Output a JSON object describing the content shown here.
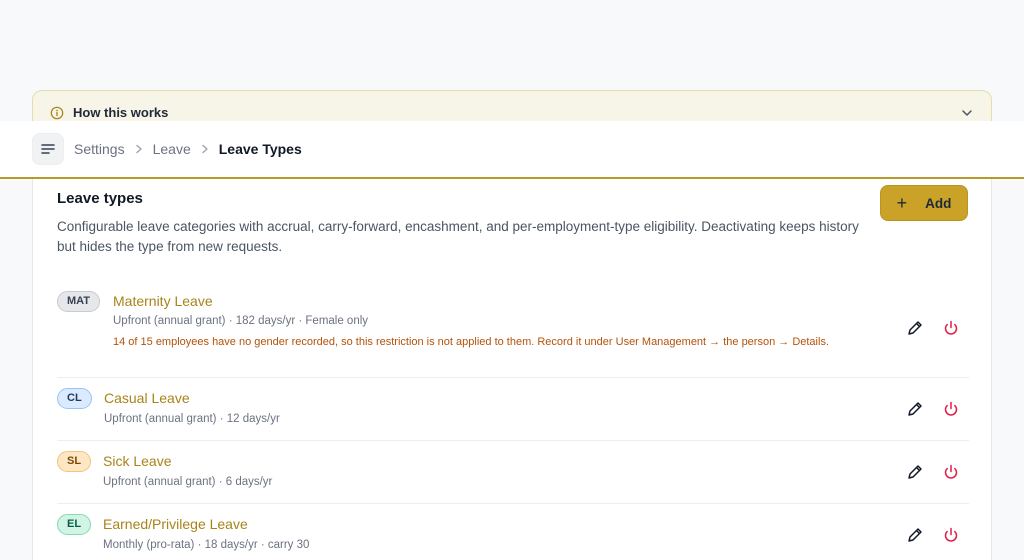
{
  "info_banner": {
    "title": "How this works",
    "icon": "info-icon"
  },
  "breadcrumb": {
    "items": [
      "Settings",
      "Leave"
    ],
    "current": "Leave Types"
  },
  "card": {
    "title": "Leave types",
    "description": "Configurable leave categories with accrual, carry-forward, encashment, and per-employment-type eligibility. Deactivating keeps history but hides the type from new requests.",
    "add_label": "Add"
  },
  "leave_types": [
    {
      "code": "MAT",
      "name": "Maternity Leave",
      "meta": "Upfront (annual grant) · 182 days/yr · Female only",
      "warning": "14 of 15 employees have no gender recorded, so this restriction is not applied to them. Record it under User Management → the person → Details."
    },
    {
      "code": "CL",
      "name": "Casual Leave",
      "meta": "Upfront (annual grant) · 12 days/yr"
    },
    {
      "code": "SL",
      "name": "Sick Leave",
      "meta": "Upfront (annual grant) · 6 days/yr"
    },
    {
      "code": "EL",
      "name": "Earned/Privilege Leave",
      "meta": "Monthly (pro-rata) · 18 days/yr · carry 30"
    }
  ],
  "colors": {
    "accent": "#c9a227",
    "danger": "#e11d48",
    "warning_text": "#b45309",
    "badge_mat": "#e5e7eb",
    "badge_cl": "#dbeafe",
    "badge_sl": "#fde7c4",
    "badge_el": "#d1f4e4"
  }
}
